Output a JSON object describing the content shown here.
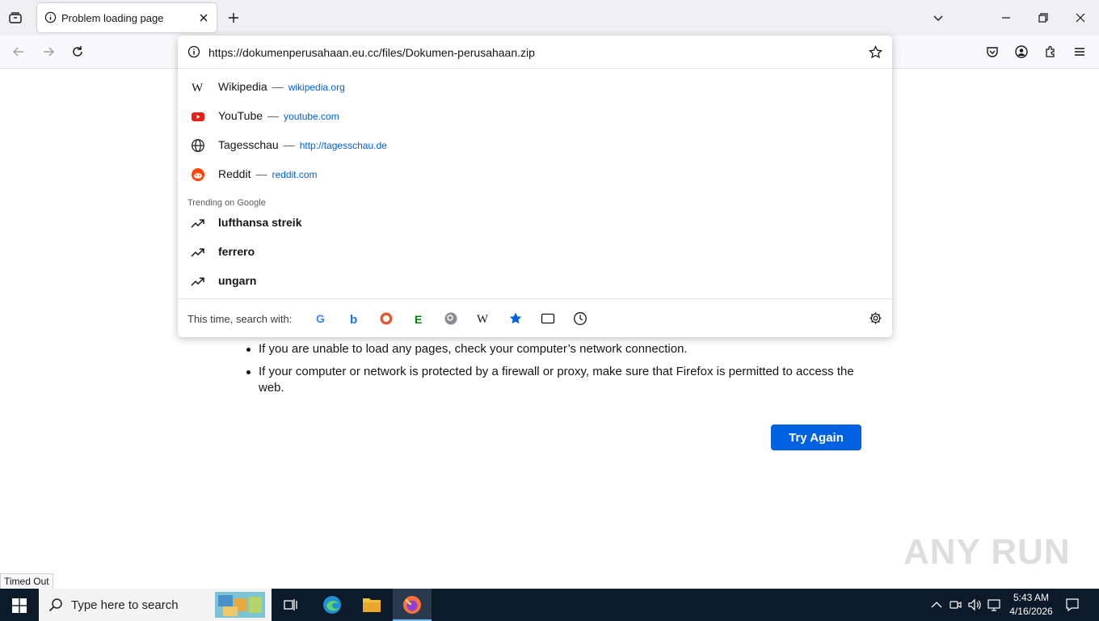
{
  "browser": {
    "tab_title": "Problem loading page",
    "url": "https://dokumenperusahaan.eu.cc/files/Dokumen-perusahaan.zip"
  },
  "suggestions": {
    "sites": [
      {
        "title": "Wikipedia",
        "url": "wikipedia.org"
      },
      {
        "title": "YouTube",
        "url": "youtube.com"
      },
      {
        "title": "Tagesschau",
        "url": "http://tagesschau.de"
      },
      {
        "title": "Reddit",
        "url": "reddit.com"
      }
    ],
    "dash": "—",
    "trending_label": "Trending on Google",
    "trending": [
      "lufthansa streik",
      "ferrero",
      "ungarn"
    ],
    "search_with_label": "This time, search with:",
    "engines": [
      "google-icon",
      "bing-icon",
      "duckduckgo-icon",
      "ecosia-icon",
      "qwant-icon",
      "wikipedia-icon",
      "bookmarks-icon",
      "tabs-icon",
      "history-icon"
    ]
  },
  "page": {
    "bullets": [
      "If you are unable to load any pages, check your computer’s network connection.",
      "If your computer or network is protected by a firewall or proxy, make sure that Firefox is permitted to access the",
      "web."
    ],
    "try_again": "Try Again",
    "status": "Timed Out",
    "watermark": "ANY RUN"
  },
  "taskbar": {
    "search_placeholder": "Type here to search",
    "time": "5:43 AM",
    "date": "4/16/2026"
  },
  "colors": {
    "accent": "#0061e0",
    "taskbar": "#0d1a2a"
  }
}
